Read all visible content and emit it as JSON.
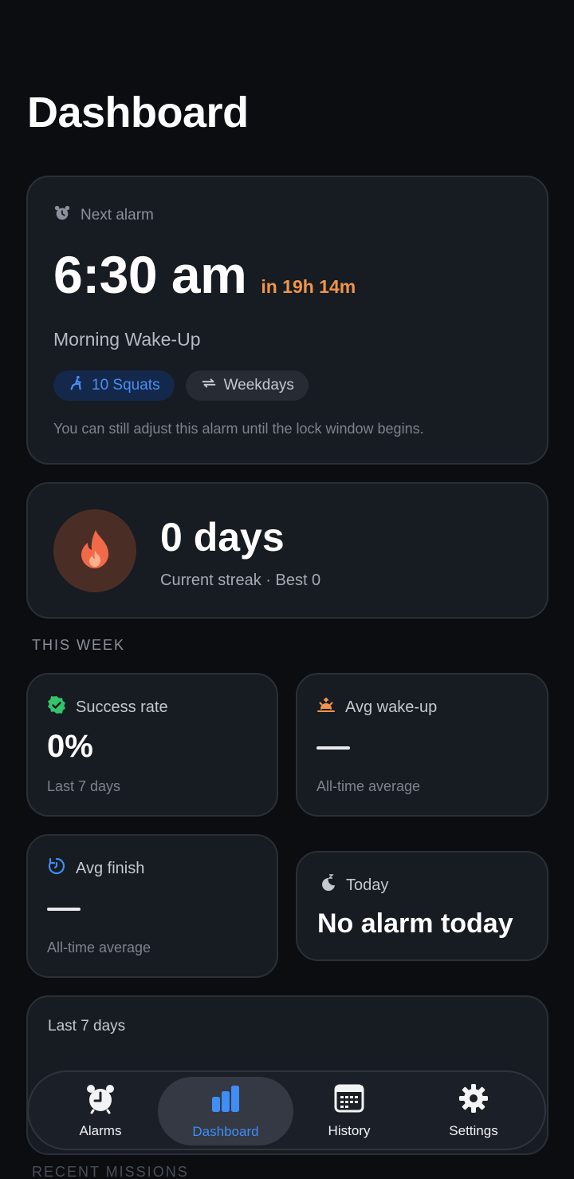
{
  "page": {
    "title": "Dashboard"
  },
  "next_alarm": {
    "label": "Next alarm",
    "time": "6:30 am",
    "countdown": "in 19h 14m",
    "name": "Morning Wake-Up",
    "mission_chip": "10 Squats",
    "repeat_chip": "Weekdays",
    "note": "You can still adjust this alarm until the lock window begins."
  },
  "streak": {
    "value": "0 days",
    "subtitle": "Current streak · Best 0"
  },
  "this_week": {
    "section_label": "THIS WEEK",
    "success_rate": {
      "label": "Success rate",
      "value": "0%",
      "sub": "Last 7 days"
    },
    "avg_wakeup": {
      "label": "Avg wake-up",
      "value": "—",
      "sub": "All-time average"
    },
    "avg_finish": {
      "label": "Avg finish",
      "value": "—",
      "sub": "All-time average"
    },
    "today": {
      "label": "Today",
      "value": "No alarm today"
    }
  },
  "last7": {
    "label": "Last 7 days"
  },
  "recent_missions": {
    "label": "RECENT MISSIONS"
  },
  "nav": {
    "alarms": "Alarms",
    "dashboard": "Dashboard",
    "history": "History",
    "settings": "Settings",
    "active": "dashboard"
  },
  "colors": {
    "background": "#0b0d11",
    "card": "#171b22",
    "accent_orange": "#f0954a",
    "accent_blue": "#3f8df5",
    "success_green": "#34c46a"
  }
}
